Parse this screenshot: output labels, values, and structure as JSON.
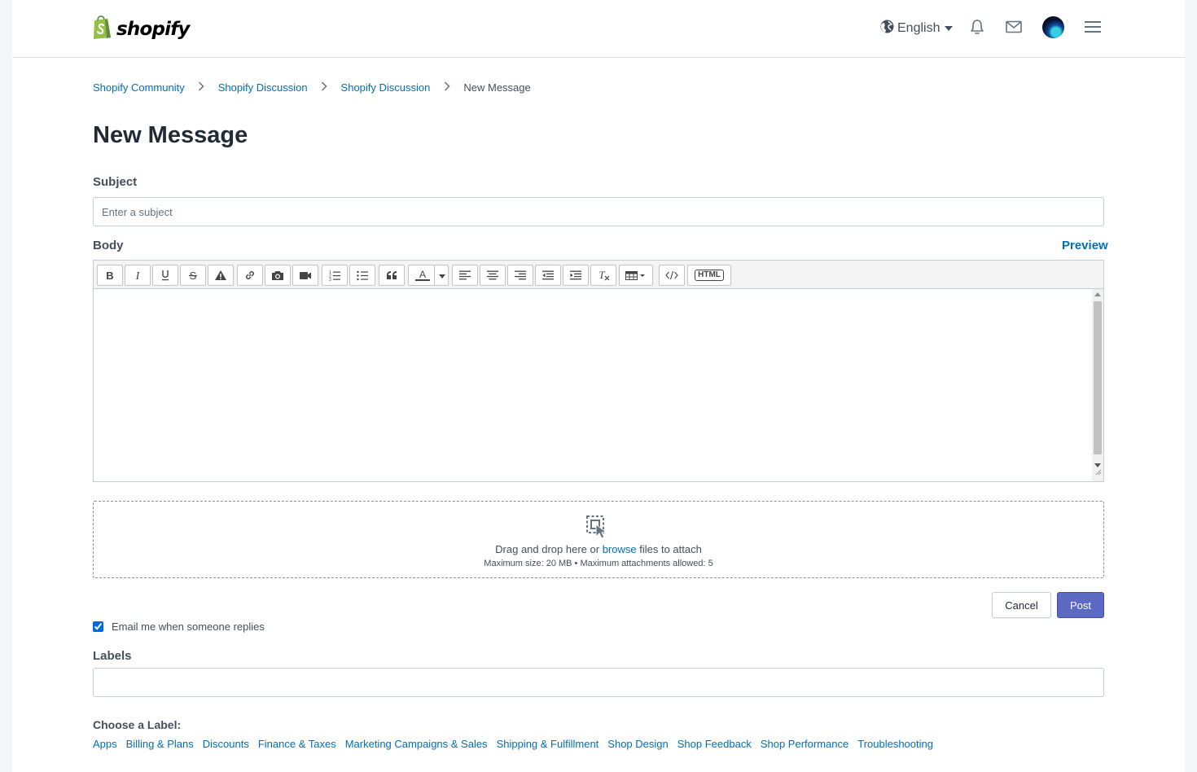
{
  "header": {
    "logo_text": "shopify",
    "language": "English"
  },
  "breadcrumb": {
    "items": [
      "Shopify Community",
      "Shopify Discussion",
      "Shopify Discussion"
    ],
    "current": "New Message"
  },
  "page": {
    "title": "New Message"
  },
  "form": {
    "subject_label": "Subject",
    "subject_placeholder": "Enter a subject",
    "subject_value": "",
    "body_label": "Body",
    "preview_label": "Preview",
    "editor_value": "",
    "toolbar": {
      "html_label": "HTML"
    },
    "dropzone": {
      "text_before": "Drag and drop here or ",
      "browse": "browse",
      "text_after": " files to attach",
      "limits": "Maximum size: 20 MB • Maximum attachments allowed: 5"
    },
    "cancel_label": "Cancel",
    "post_label": "Post",
    "email_checkbox_label": "Email me when someone replies",
    "email_checked": true,
    "labels_label": "Labels",
    "labels_value": "",
    "choose_label": "Choose a Label:",
    "label_options": [
      "Apps",
      "Billing & Plans",
      "Discounts",
      "Finance & Taxes",
      "Marketing Campaigns & Sales",
      "Shipping & Fulfillment",
      "Shop Design",
      "Shop Feedback",
      "Shop Performance",
      "Troubleshooting"
    ]
  },
  "colors": {
    "link": "#006fbb",
    "primary_button": "#5c6ac4",
    "brand_green": "#95bf47"
  },
  "icons": [
    "shopify-bag-icon",
    "globe-icon",
    "bell-icon",
    "mail-icon",
    "hamburger-menu-icon",
    "drag-drop-icon"
  ]
}
